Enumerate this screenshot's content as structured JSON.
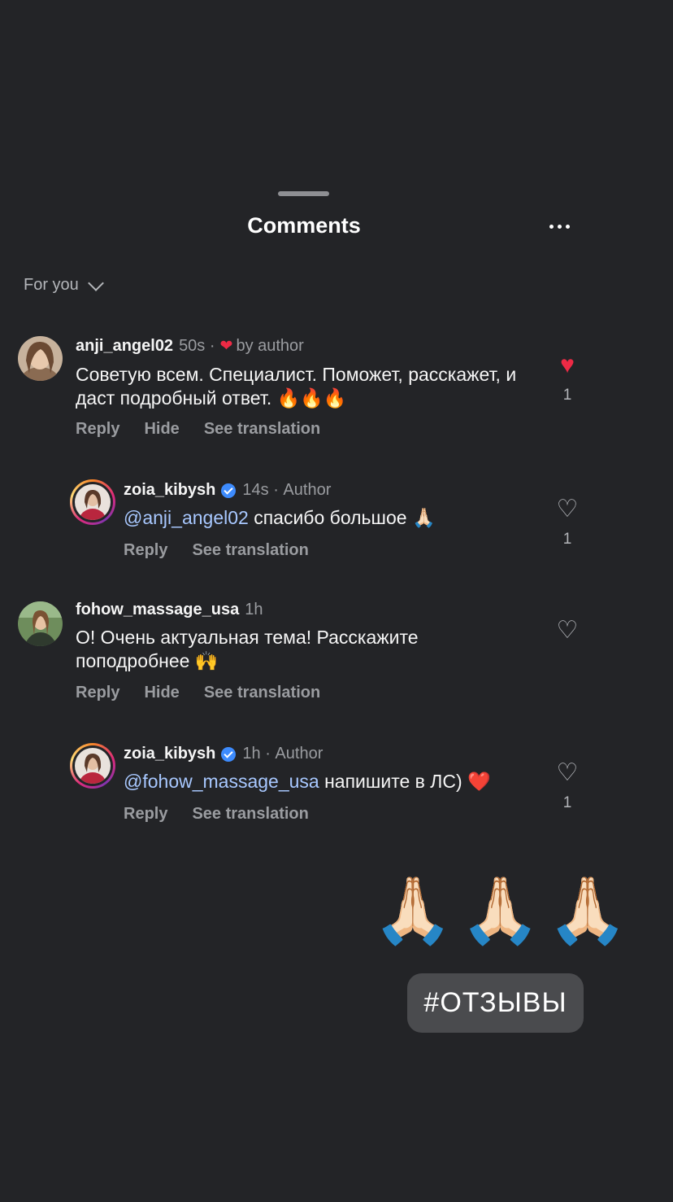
{
  "header": {
    "title": "Comments",
    "more_icon": "more-horizontal-icon"
  },
  "sort": {
    "label": "For you",
    "icon": "chevron-down-icon"
  },
  "comments": [
    {
      "user": "anji_angel02",
      "time": "50s",
      "author_liked": "by author",
      "text": "Советую всем. Специалист. Поможет, расскажет, и даст подробный ответ. 🔥🔥🔥",
      "actions": {
        "reply": "Reply",
        "hide": "Hide",
        "translate": "See translation"
      },
      "likes": "1",
      "liked": true
    },
    {
      "user": "zoia_kibysh",
      "time": "14s",
      "role": "Author",
      "mention": "@anji_angel02",
      "text": " спасибо большое 🙏🏻",
      "actions": {
        "reply": "Reply",
        "translate": "See translation"
      },
      "likes": "1",
      "liked": false
    },
    {
      "user": "fohow_massage_usa",
      "time": "1h",
      "text": "О! Очень актуальная тема! Расскажите поподробнее 🙌",
      "actions": {
        "reply": "Reply",
        "hide": "Hide",
        "translate": "See translation"
      },
      "liked": false
    },
    {
      "user": "zoia_kibysh",
      "time": "1h",
      "role": "Author",
      "mention": "@fohow_massage_usa",
      "text": " напишите в ЛС) ❤️",
      "actions": {
        "reply": "Reply",
        "translate": "See translation"
      },
      "likes": "1",
      "liked": false
    }
  ],
  "overlay": {
    "emoji": "🙏🏻🙏🏻🙏🏻",
    "hashtag": "#ОТЗЫВЫ"
  },
  "colors": {
    "background": "#232427",
    "like_red": "#ed2a45",
    "mention": "#a8c8ff",
    "verified": "#3d8bfd"
  }
}
